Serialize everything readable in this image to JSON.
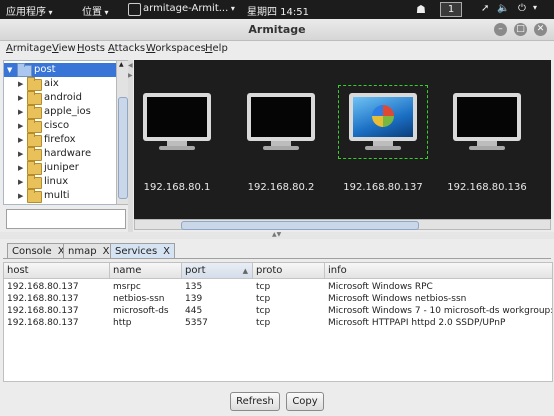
{
  "panel": {
    "apps": "应用程序",
    "places": "位置",
    "task": "armitage-Armit...",
    "clock": "星期四 14:51",
    "workspace": "1"
  },
  "window": {
    "title": "Armitage"
  },
  "menu": [
    "Armitage",
    "View",
    "Hosts",
    "Attacks",
    "Workspaces",
    "Help"
  ],
  "tree": {
    "root": "post",
    "children": [
      "aix",
      "android",
      "apple_ios",
      "cisco",
      "firefox",
      "hardware",
      "juniper",
      "linux",
      "multi"
    ]
  },
  "search": {
    "value": ""
  },
  "hosts": [
    {
      "ip": "192.168.80.1",
      "os": "unknown",
      "selected": false
    },
    {
      "ip": "192.168.80.2",
      "os": "unknown",
      "selected": false
    },
    {
      "ip": "192.168.80.137",
      "os": "windows",
      "selected": true
    },
    {
      "ip": "192.168.80.136",
      "os": "unknown",
      "selected": false
    }
  ],
  "tabs": [
    {
      "label": "Console",
      "close": "X",
      "active": false
    },
    {
      "label": "nmap",
      "close": "X",
      "active": false
    },
    {
      "label": "Services",
      "close": "X",
      "active": true
    }
  ],
  "table": {
    "columns": [
      "host",
      "name",
      "port",
      "proto",
      "info"
    ],
    "sort_column": "port",
    "rows": [
      [
        "192.168.80.137",
        "msrpc",
        "135",
        "tcp",
        "Microsoft Windows RPC"
      ],
      [
        "192.168.80.137",
        "netbios-ssn",
        "139",
        "tcp",
        "Microsoft Windows netbios-ssn"
      ],
      [
        "192.168.80.137",
        "microsoft-ds",
        "445",
        "tcp",
        "Microsoft Windows 7 - 10 microsoft-ds workgroup:..."
      ],
      [
        "192.168.80.137",
        "http",
        "5357",
        "tcp",
        "Microsoft HTTPAPI httpd 2.0 SSDP/UPnP"
      ]
    ]
  },
  "buttons": {
    "refresh": "Refresh",
    "copy": "Copy"
  },
  "colors": {
    "selection": "#3875d7",
    "canvas": "#1d1d1d",
    "host_select_box": "#35d12a"
  }
}
